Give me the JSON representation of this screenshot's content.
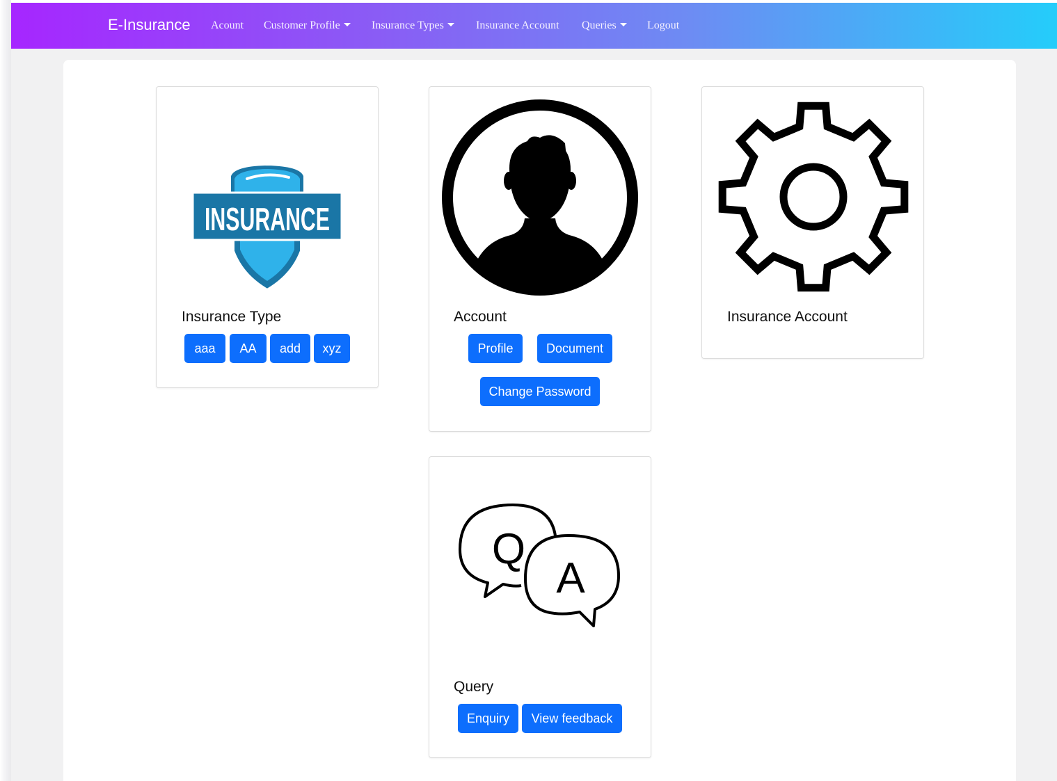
{
  "navbar": {
    "brand": "E-Insurance",
    "items": [
      {
        "label": "Acount",
        "dropdown": false
      },
      {
        "label": "Customer Profile",
        "dropdown": true
      },
      {
        "label": "Insurance Types",
        "dropdown": true
      },
      {
        "label": "Insurance Account",
        "dropdown": false
      },
      {
        "label": "Queries",
        "dropdown": true
      },
      {
        "label": "Logout",
        "dropdown": false
      }
    ]
  },
  "cards": {
    "insurance_type": {
      "logo_text": "INSURANCE",
      "title": "Insurance Type",
      "buttons": [
        "aaa",
        "AA",
        "add",
        "xyz"
      ]
    },
    "account": {
      "title": "Account",
      "buttons": [
        "Profile",
        "Document",
        "Change Password"
      ]
    },
    "insurance_account": {
      "title": "Insurance Account"
    },
    "query": {
      "title": "Query",
      "bubble_q": "Q",
      "bubble_a": "A",
      "buttons": [
        "Enquiry",
        "View feedback"
      ]
    }
  },
  "icons": {
    "insurance_logo": "insurance-shield-logo",
    "account": "user-avatar-icon",
    "insurance_account": "gear-icon",
    "query": "qa-chat-bubbles-icon"
  },
  "colors": {
    "primary_button": "#0d6efd",
    "navbar_gradient_start": "#a626ff",
    "navbar_gradient_end": "#24cdfa",
    "shield_dark": "#1a76a6",
    "shield_light": "#2fb2ea"
  }
}
